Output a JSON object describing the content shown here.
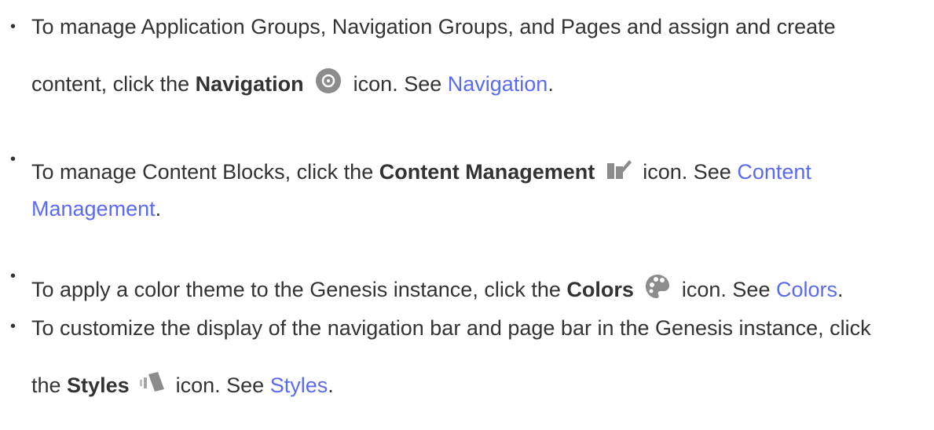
{
  "items": [
    {
      "line1": "To manage Application Groups, Navigation Groups, and Pages and assign and create",
      "line2_pre": "content, click the ",
      "bold": "Navigation",
      "icon": "compass-icon",
      "post": " icon. See ",
      "link": "Navigation",
      "end": "."
    },
    {
      "pre": "To manage Content Blocks, click the ",
      "bold": "Content Management",
      "icon": "content-management-icon",
      "post": " icon. See ",
      "link_part1": "Content",
      "link_part2": "Management",
      "end": "."
    },
    {
      "pre": "To apply a color theme to the Genesis instance, click the ",
      "bold": "Colors",
      "icon": "palette-icon",
      "post": " icon. See ",
      "link": "Colors",
      "end": "."
    },
    {
      "line1": "To customize the display of the navigation bar and page bar in the Genesis instance, click",
      "line2_pre": "the ",
      "bold": "Styles",
      "icon": "styles-icon",
      "post": " icon. See ",
      "link": "Styles",
      "end": "."
    }
  ],
  "colors": {
    "text": "#333333",
    "link": "#5b6bf0",
    "icon_gray": "#8c8c8c"
  }
}
